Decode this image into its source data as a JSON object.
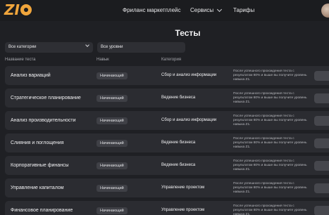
{
  "header": {
    "logo_text": "ZIO",
    "nav": {
      "freelance": "Фриланс маркетплейс",
      "services": "Сервисы",
      "pricing": "Тарифы"
    }
  },
  "page_title": "Тесты",
  "filters": {
    "categories": {
      "selected": "Все категории"
    },
    "levels": {
      "selected": "Все уровни"
    }
  },
  "columns": {
    "name": "Название теста",
    "skill": "Навык",
    "category": "Категория"
  },
  "tests": [
    {
      "name": "Анализ вариаций",
      "skill": "Начинающий",
      "category": "Сбор и анализ информации",
      "desc": "После успешного прохождения теста с результатом 80% и выше вы получите уровень навыка Z1."
    },
    {
      "name": "Стратегическое планирование",
      "skill": "Начинающий",
      "category": "Ведение бизнеса",
      "desc": "После успешного прохождения теста с результатом 80% и выше вы получите уровень навыка Z1."
    },
    {
      "name": "Анализ производительности",
      "skill": "Начинающий",
      "category": "Сбор и анализ информации",
      "desc": "После успешного прохождения теста с результатом 80% и выше вы получите уровень навыка Z1."
    },
    {
      "name": "Слияния и поглощения",
      "skill": "Начинающий",
      "category": "Ведение бизнеса",
      "desc": "После успешного прохождения теста с результатом 80% и выше вы получите уровень навыка Z1."
    },
    {
      "name": "Корпоративные финансы",
      "skill": "Начинающий",
      "category": "Ведение бизнеса",
      "desc": "После успешного прохождения теста с результатом 80% и выше вы получите уровень навыка Z1."
    },
    {
      "name": "Управление капиталом",
      "skill": "Начинающий",
      "category": "Управление проектом",
      "desc": "После успешного прохождения теста с результатом 80% и выше вы получите уровень навыка Z1."
    },
    {
      "name": "Финансовое планирование",
      "skill": "Начинающий",
      "category": "Управление проектом",
      "desc": "После успешного прохождения теста с результатом 80% и выше вы получите уровень навыка Z1."
    }
  ]
}
